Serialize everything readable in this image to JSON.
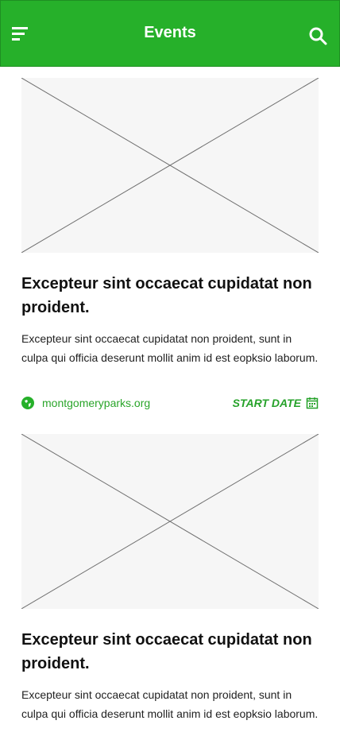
{
  "header": {
    "title": "Events",
    "background": "#26b02a",
    "menu_icon": "menu-icon",
    "search_icon": "search-icon"
  },
  "events": [
    {
      "title": "Excepteur sint occaecat cupidatat non proident.",
      "description": "Excepteur sint occaecat cupidatat non proident, sunt in culpa qui officia deserunt mollit anim id est eopksio laborum.",
      "website": "montgomeryparks.org",
      "start_label": "START DATE"
    },
    {
      "title": "Excepteur sint occaecat cupidatat non proident.",
      "description": "Excepteur sint occaecat cupidatat non proident, sunt in culpa qui officia deserunt mollit anim id est eopksio laborum."
    }
  ],
  "colors": {
    "accent": "#26b02a",
    "link": "#2aa52a",
    "placeholder_bg": "#f6f6f6"
  }
}
